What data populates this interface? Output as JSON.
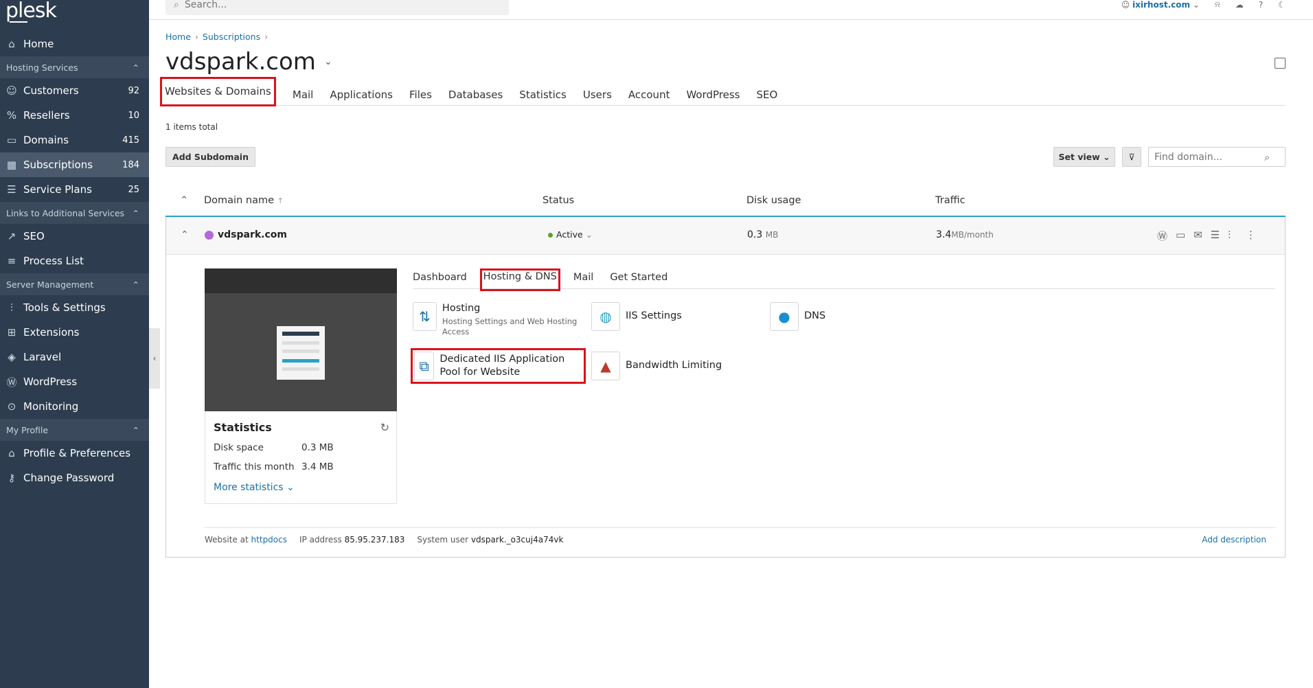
{
  "app": {
    "logo": "plesk"
  },
  "sidebar": {
    "home": "Home",
    "sections": [
      {
        "title": "Hosting Services",
        "items": [
          {
            "label": "Customers",
            "count": "92"
          },
          {
            "label": "Resellers",
            "count": "10"
          },
          {
            "label": "Domains",
            "count": "415"
          },
          {
            "label": "Subscriptions",
            "count": "184"
          },
          {
            "label": "Service Plans",
            "count": "25"
          }
        ]
      },
      {
        "title": "Links to Additional Services",
        "items": [
          {
            "label": "SEO"
          },
          {
            "label": "Process List"
          }
        ]
      },
      {
        "title": "Server Management",
        "items": [
          {
            "label": "Tools & Settings"
          },
          {
            "label": "Extensions"
          },
          {
            "label": "Laravel"
          },
          {
            "label": "WordPress"
          },
          {
            "label": "Monitoring"
          }
        ]
      },
      {
        "title": "My Profile",
        "items": [
          {
            "label": "Profile & Preferences"
          },
          {
            "label": "Change Password"
          }
        ]
      }
    ]
  },
  "topbar": {
    "search_placeholder": "Search...",
    "user": "ixirhost.com"
  },
  "breadcrumb": [
    "Home",
    "Subscriptions"
  ],
  "page": {
    "title": "vdspark.com"
  },
  "tabs": [
    "Websites & Domains",
    "Mail",
    "Applications",
    "Files",
    "Databases",
    "Statistics",
    "Users",
    "Account",
    "WordPress",
    "SEO"
  ],
  "list": {
    "items_total": "1 items total",
    "add_subdomain": "Add Subdomain",
    "set_view": "Set view",
    "find_placeholder": "Find domain...",
    "columns": [
      "Domain name",
      "Status",
      "Disk usage",
      "Traffic"
    ]
  },
  "domain": {
    "name": "vdspark.com",
    "status": "Active",
    "disk": "0.3",
    "disk_unit": "MB",
    "traffic": "3.4",
    "traffic_unit": "MB/month",
    "stats": {
      "title": "Statistics",
      "disk_label": "Disk space",
      "disk_value": "0.3 MB",
      "traffic_label": "Traffic this month",
      "traffic_value": "3.4 MB",
      "more": "More statistics"
    },
    "inner_tabs": [
      "Dashboard",
      "Hosting & DNS",
      "Mail",
      "Get Started"
    ],
    "tools": {
      "hosting": {
        "name": "Hosting",
        "desc": "Hosting Settings and Web Hosting Access"
      },
      "iis": {
        "name": "IIS Settings"
      },
      "dns": {
        "name": "DNS"
      },
      "pool": {
        "name": "Dedicated IIS Application Pool for Website"
      },
      "bandwidth": {
        "name": "Bandwidth Limiting"
      }
    },
    "footer": {
      "website_at": "Website at",
      "httpdocs": "httpdocs",
      "ip_label": "IP address",
      "ip": "85.95.237.183",
      "user_label": "System user",
      "user": "vdspark._o3cuj4a74vk",
      "add_description": "Add description"
    }
  }
}
